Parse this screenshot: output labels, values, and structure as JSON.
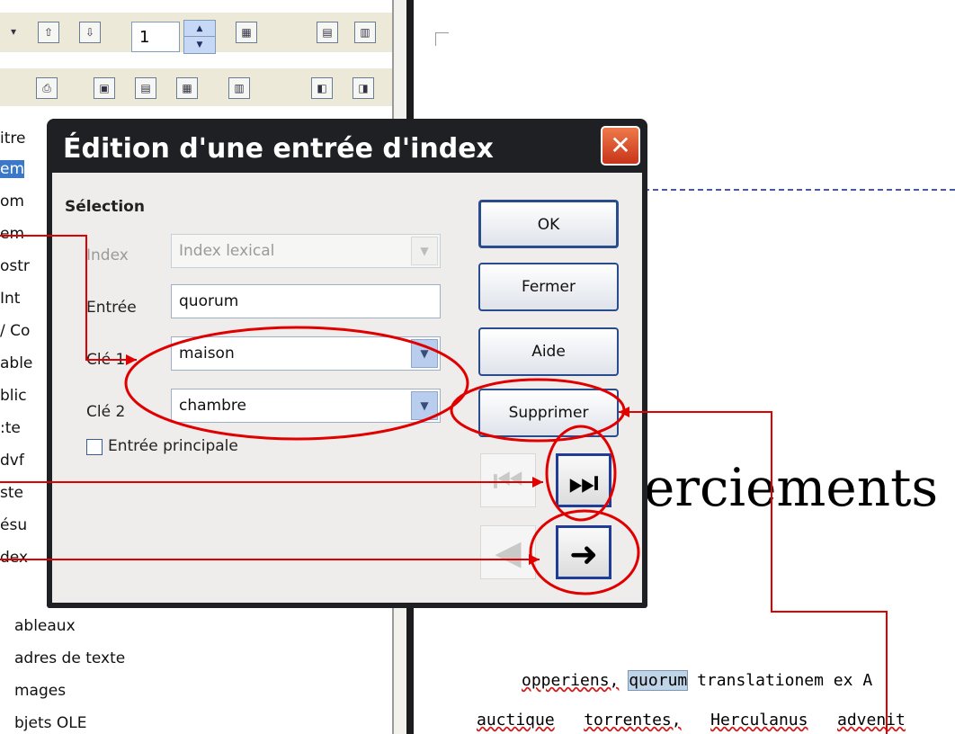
{
  "navigator": {
    "spin_value": "1",
    "partial_items": [
      "itre",
      "em",
      "om",
      "em",
      "ostr",
      " Int",
      "/ Co",
      "able",
      "blic",
      ":te",
      "dvf",
      "ste",
      "ésu",
      "dex"
    ],
    "items": [
      "ableaux",
      "adres de texte",
      "mages",
      "bjets OLE"
    ]
  },
  "dialog": {
    "title": "Édition d'une entrée d'index",
    "close_icon": "close-icon",
    "section": "Sélection",
    "index_label": "Index",
    "index_value": "Index lexical",
    "entry_label": "Entrée",
    "entry_value": "quorum",
    "key1_label": "Clé 1",
    "key1_value": "maison",
    "key2_label": "Clé 2",
    "key2_value": "chambre",
    "main_entry_label": "Entrée principale",
    "ok": "OK",
    "close": "Fermer",
    "help": "Aide",
    "delete": "Supprimer"
  },
  "document": {
    "heading": "erciements",
    "line1": [
      "opperiens,",
      "quorum",
      "translationem ex A"
    ],
    "line2": [
      "auctique",
      "torrentes,",
      "Herculanus",
      "advenit"
    ]
  },
  "colors": {
    "annotation": "#e00000",
    "title_bar": "#1f2024"
  }
}
